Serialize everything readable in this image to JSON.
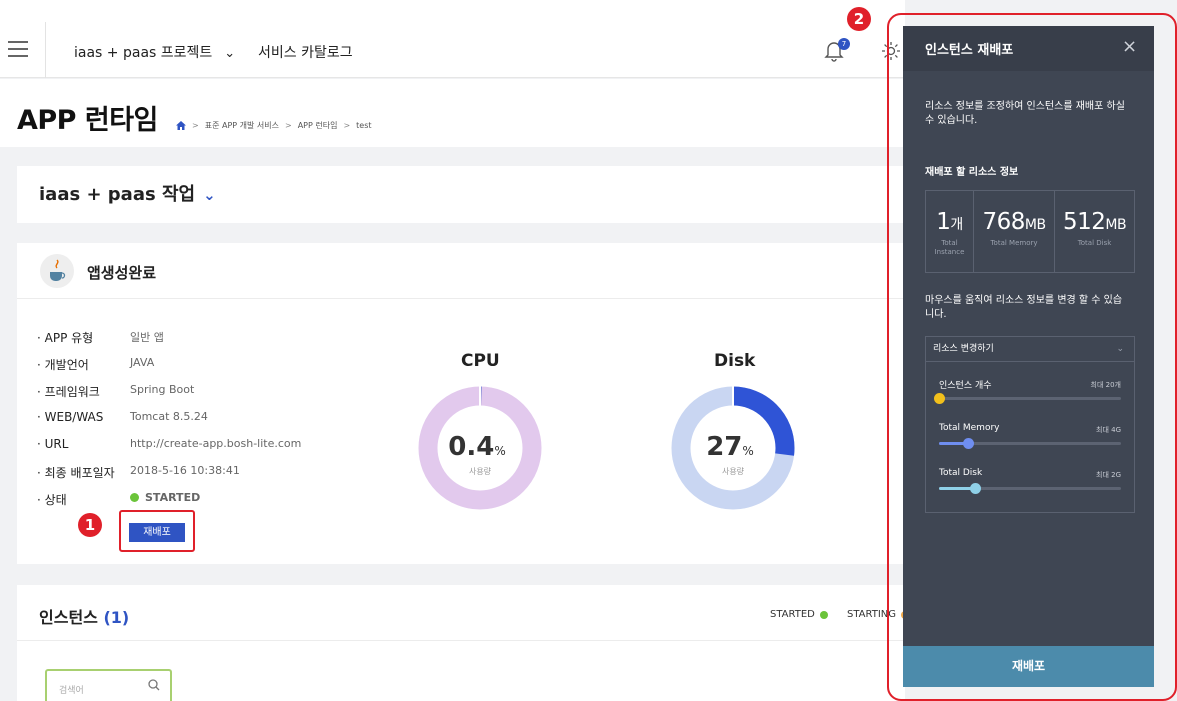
{
  "header": {
    "project_label": "iaas + paas 프로젝트",
    "catalog_label": "서비스 카탈로그",
    "notification_count": "7"
  },
  "page": {
    "title": "APP 런타임",
    "breadcrumb": [
      "표준 APP 개발 서비스",
      "APP 런타임",
      "test"
    ]
  },
  "workspace": {
    "title": "iaas + paas 작업"
  },
  "app": {
    "name": "앱생성완료",
    "fields": [
      {
        "label": "· APP 유형",
        "value": "일반 앱"
      },
      {
        "label": "· 개발언어",
        "value": "JAVA"
      },
      {
        "label": "· 프레임워크",
        "value": "Spring Boot"
      },
      {
        "label": "· WEB/WAS",
        "value": "Tomcat 8.5.24"
      },
      {
        "label": "· URL",
        "value": "http://create-app.bosh-lite.com"
      },
      {
        "label": "· 최종 배포일자",
        "value": "2018-5-16 10:38:41"
      }
    ],
    "status_label": "· 상태",
    "status_value": "STARTED",
    "redeploy_label": "재배포"
  },
  "charts": {
    "cpu": {
      "title": "CPU",
      "value": "0.4",
      "unit": "%",
      "caption": "사용량",
      "fraction": 0.004,
      "color": "#2f54c3",
      "track": "#e2c9ed"
    },
    "disk": {
      "title": "Disk",
      "value": "27",
      "unit": "%",
      "caption": "사용량",
      "fraction": 0.27,
      "color": "#2f54d6",
      "track": "#c9d6f2"
    }
  },
  "instances": {
    "title": "인스턴스",
    "count": "(1)",
    "legend": [
      {
        "label": "STARTED",
        "color": "#6bc43a"
      },
      {
        "label": "STARTING",
        "color": "#f0a848"
      }
    ],
    "search_placeholder": "검색어"
  },
  "markers": [
    "1",
    "2"
  ],
  "panel": {
    "title": "인스턴스 재배포",
    "description": "리소스 정보를 조정하여 인스턴스를 재배포 하실 수 있습니다.",
    "resource_heading": "재배포 할 리소스 정보",
    "stats": [
      {
        "value": "1",
        "unit": "개",
        "caption": "Total Instance"
      },
      {
        "value": "768",
        "unit": "MB",
        "caption": "Total Memory"
      },
      {
        "value": "512",
        "unit": "MB",
        "caption": "Total Disk"
      }
    ],
    "mouse_hint": "마우스를 움직여 리소스 정보를 변경 할 수 있습니다.",
    "dropdown_label": "리소스 변경하기",
    "sliders": [
      {
        "label": "인스턴스 개수",
        "max": "최대 20개",
        "level": 0.0,
        "color": "#f2c01c"
      },
      {
        "label": "Total Memory",
        "max": "최대 4G",
        "level": 0.16,
        "color": "#6f8ef0"
      },
      {
        "label": "Total Disk",
        "max": "최대 2G",
        "level": 0.2,
        "color": "#8fd0e8"
      }
    ],
    "submit_label": "재배포"
  }
}
